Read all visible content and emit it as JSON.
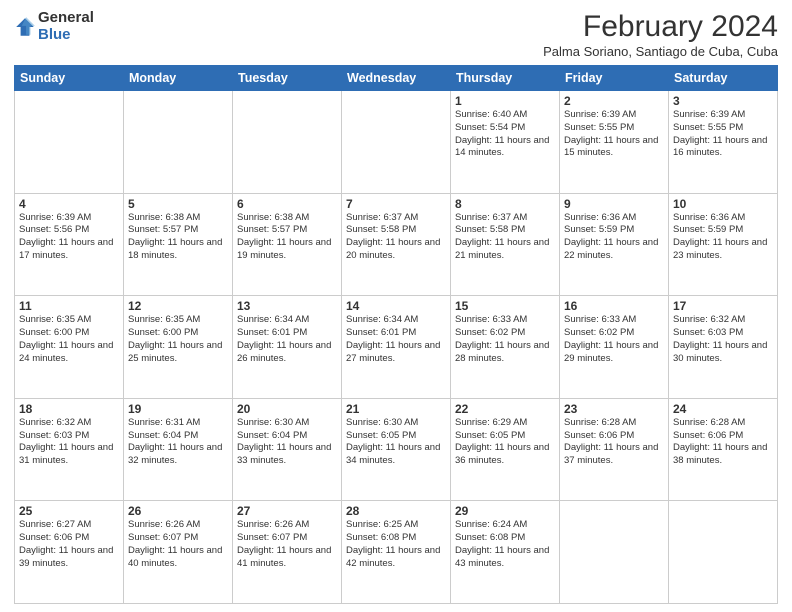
{
  "header": {
    "logo_general": "General",
    "logo_blue": "Blue",
    "month_year": "February 2024",
    "location": "Palma Soriano, Santiago de Cuba, Cuba"
  },
  "days_of_week": [
    "Sunday",
    "Monday",
    "Tuesday",
    "Wednesday",
    "Thursday",
    "Friday",
    "Saturday"
  ],
  "weeks": [
    [
      {
        "day": "",
        "info": ""
      },
      {
        "day": "",
        "info": ""
      },
      {
        "day": "",
        "info": ""
      },
      {
        "day": "",
        "info": ""
      },
      {
        "day": "1",
        "info": "Sunrise: 6:40 AM\nSunset: 5:54 PM\nDaylight: 11 hours and 14 minutes."
      },
      {
        "day": "2",
        "info": "Sunrise: 6:39 AM\nSunset: 5:55 PM\nDaylight: 11 hours and 15 minutes."
      },
      {
        "day": "3",
        "info": "Sunrise: 6:39 AM\nSunset: 5:55 PM\nDaylight: 11 hours and 16 minutes."
      }
    ],
    [
      {
        "day": "4",
        "info": "Sunrise: 6:39 AM\nSunset: 5:56 PM\nDaylight: 11 hours and 17 minutes."
      },
      {
        "day": "5",
        "info": "Sunrise: 6:38 AM\nSunset: 5:57 PM\nDaylight: 11 hours and 18 minutes."
      },
      {
        "day": "6",
        "info": "Sunrise: 6:38 AM\nSunset: 5:57 PM\nDaylight: 11 hours and 19 minutes."
      },
      {
        "day": "7",
        "info": "Sunrise: 6:37 AM\nSunset: 5:58 PM\nDaylight: 11 hours and 20 minutes."
      },
      {
        "day": "8",
        "info": "Sunrise: 6:37 AM\nSunset: 5:58 PM\nDaylight: 11 hours and 21 minutes."
      },
      {
        "day": "9",
        "info": "Sunrise: 6:36 AM\nSunset: 5:59 PM\nDaylight: 11 hours and 22 minutes."
      },
      {
        "day": "10",
        "info": "Sunrise: 6:36 AM\nSunset: 5:59 PM\nDaylight: 11 hours and 23 minutes."
      }
    ],
    [
      {
        "day": "11",
        "info": "Sunrise: 6:35 AM\nSunset: 6:00 PM\nDaylight: 11 hours and 24 minutes."
      },
      {
        "day": "12",
        "info": "Sunrise: 6:35 AM\nSunset: 6:00 PM\nDaylight: 11 hours and 25 minutes."
      },
      {
        "day": "13",
        "info": "Sunrise: 6:34 AM\nSunset: 6:01 PM\nDaylight: 11 hours and 26 minutes."
      },
      {
        "day": "14",
        "info": "Sunrise: 6:34 AM\nSunset: 6:01 PM\nDaylight: 11 hours and 27 minutes."
      },
      {
        "day": "15",
        "info": "Sunrise: 6:33 AM\nSunset: 6:02 PM\nDaylight: 11 hours and 28 minutes."
      },
      {
        "day": "16",
        "info": "Sunrise: 6:33 AM\nSunset: 6:02 PM\nDaylight: 11 hours and 29 minutes."
      },
      {
        "day": "17",
        "info": "Sunrise: 6:32 AM\nSunset: 6:03 PM\nDaylight: 11 hours and 30 minutes."
      }
    ],
    [
      {
        "day": "18",
        "info": "Sunrise: 6:32 AM\nSunset: 6:03 PM\nDaylight: 11 hours and 31 minutes."
      },
      {
        "day": "19",
        "info": "Sunrise: 6:31 AM\nSunset: 6:04 PM\nDaylight: 11 hours and 32 minutes."
      },
      {
        "day": "20",
        "info": "Sunrise: 6:30 AM\nSunset: 6:04 PM\nDaylight: 11 hours and 33 minutes."
      },
      {
        "day": "21",
        "info": "Sunrise: 6:30 AM\nSunset: 6:05 PM\nDaylight: 11 hours and 34 minutes."
      },
      {
        "day": "22",
        "info": "Sunrise: 6:29 AM\nSunset: 6:05 PM\nDaylight: 11 hours and 36 minutes."
      },
      {
        "day": "23",
        "info": "Sunrise: 6:28 AM\nSunset: 6:06 PM\nDaylight: 11 hours and 37 minutes."
      },
      {
        "day": "24",
        "info": "Sunrise: 6:28 AM\nSunset: 6:06 PM\nDaylight: 11 hours and 38 minutes."
      }
    ],
    [
      {
        "day": "25",
        "info": "Sunrise: 6:27 AM\nSunset: 6:06 PM\nDaylight: 11 hours and 39 minutes."
      },
      {
        "day": "26",
        "info": "Sunrise: 6:26 AM\nSunset: 6:07 PM\nDaylight: 11 hours and 40 minutes."
      },
      {
        "day": "27",
        "info": "Sunrise: 6:26 AM\nSunset: 6:07 PM\nDaylight: 11 hours and 41 minutes."
      },
      {
        "day": "28",
        "info": "Sunrise: 6:25 AM\nSunset: 6:08 PM\nDaylight: 11 hours and 42 minutes."
      },
      {
        "day": "29",
        "info": "Sunrise: 6:24 AM\nSunset: 6:08 PM\nDaylight: 11 hours and 43 minutes."
      },
      {
        "day": "",
        "info": ""
      },
      {
        "day": "",
        "info": ""
      }
    ]
  ]
}
